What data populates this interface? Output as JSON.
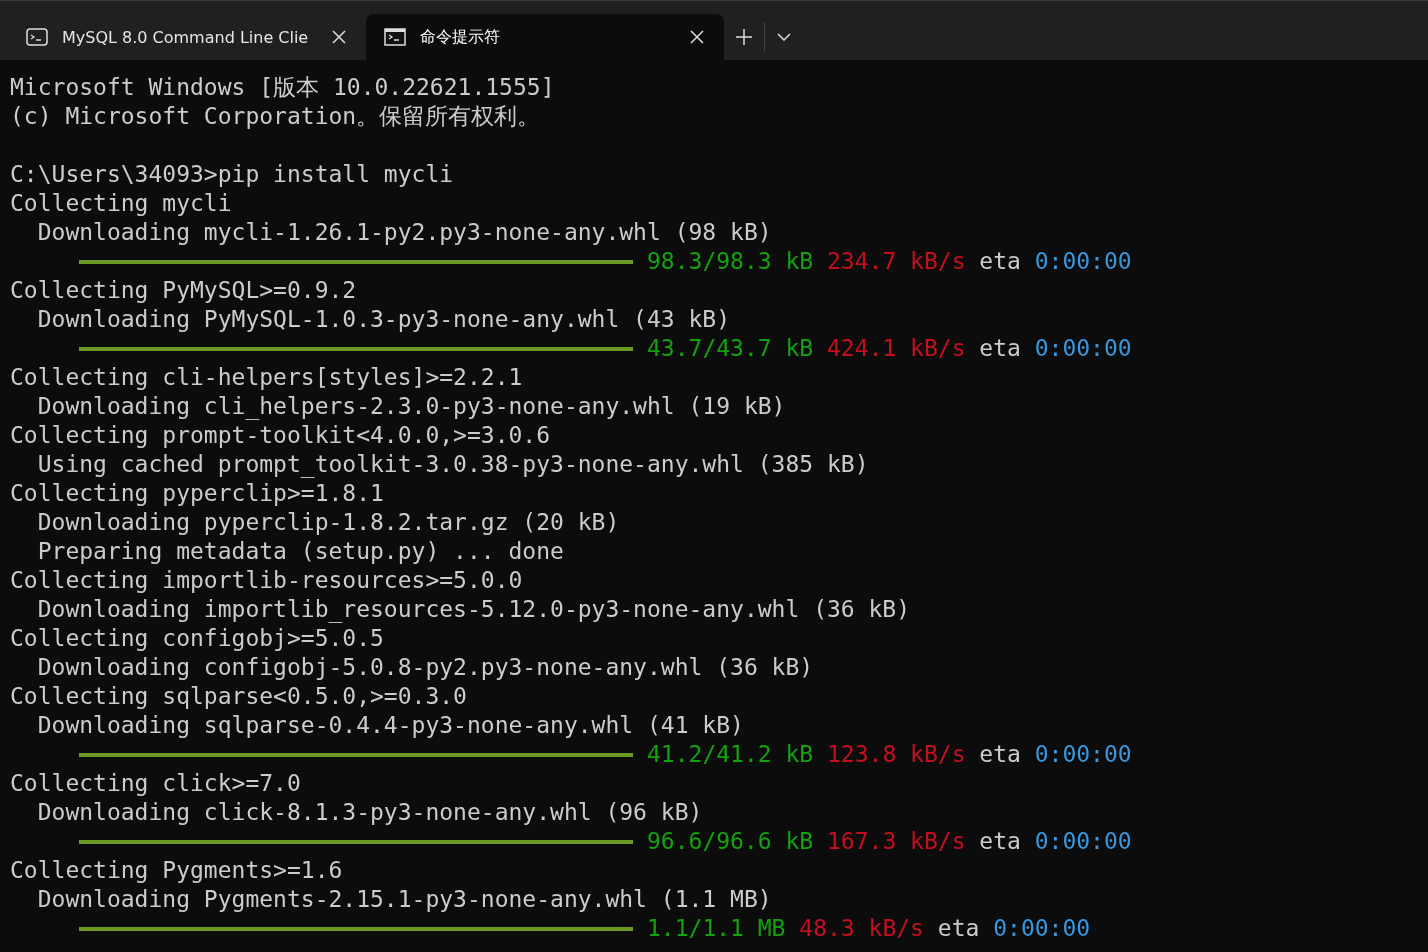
{
  "tabs": [
    {
      "title": "MySQL 8.0 Command Line Clie",
      "selected": false
    },
    {
      "title": "命令提示符",
      "selected": true
    }
  ],
  "terminal": {
    "lines": [
      {
        "kind": "text",
        "text": "Microsoft Windows [版本 10.0.22621.1555]"
      },
      {
        "kind": "text",
        "text": "(c) Microsoft Corporation。保留所有权利。"
      },
      {
        "kind": "blank"
      },
      {
        "kind": "text",
        "text": "C:\\Users\\34093>pip install mycli"
      },
      {
        "kind": "text",
        "text": "Collecting mycli"
      },
      {
        "kind": "text",
        "text": "  Downloading mycli-1.26.1-py2.py3-none-any.whl (98 kB)"
      },
      {
        "kind": "progress",
        "level": 1,
        "amount": "98.3/98.3 kB",
        "speed": "234.7 kB/s",
        "eta_label": "eta",
        "eta": "0:00:00"
      },
      {
        "kind": "text",
        "text": "Collecting PyMySQL>=0.9.2"
      },
      {
        "kind": "text",
        "text": "  Downloading PyMySQL-1.0.3-py3-none-any.whl (43 kB)"
      },
      {
        "kind": "progress",
        "level": 1,
        "amount": "43.7/43.7 kB",
        "speed": "424.1 kB/s",
        "eta_label": "eta",
        "eta": "0:00:00"
      },
      {
        "kind": "text",
        "text": "Collecting cli-helpers[styles]>=2.2.1"
      },
      {
        "kind": "text",
        "text": "  Downloading cli_helpers-2.3.0-py3-none-any.whl (19 kB)"
      },
      {
        "kind": "text",
        "text": "Collecting prompt-toolkit<4.0.0,>=3.0.6"
      },
      {
        "kind": "text",
        "text": "  Using cached prompt_toolkit-3.0.38-py3-none-any.whl (385 kB)"
      },
      {
        "kind": "text",
        "text": "Collecting pyperclip>=1.8.1"
      },
      {
        "kind": "text",
        "text": "  Downloading pyperclip-1.8.2.tar.gz (20 kB)"
      },
      {
        "kind": "text",
        "text": "  Preparing metadata (setup.py) ... done"
      },
      {
        "kind": "text",
        "text": "Collecting importlib-resources>=5.0.0"
      },
      {
        "kind": "text",
        "text": "  Downloading importlib_resources-5.12.0-py3-none-any.whl (36 kB)"
      },
      {
        "kind": "text",
        "text": "Collecting configobj>=5.0.5"
      },
      {
        "kind": "text",
        "text": "  Downloading configobj-5.0.8-py2.py3-none-any.whl (36 kB)"
      },
      {
        "kind": "text",
        "text": "Collecting sqlparse<0.5.0,>=0.3.0"
      },
      {
        "kind": "text",
        "text": "  Downloading sqlparse-0.4.4-py3-none-any.whl (41 kB)"
      },
      {
        "kind": "progress",
        "level": 1,
        "amount": "41.2/41.2 kB",
        "speed": "123.8 kB/s",
        "eta_label": "eta",
        "eta": "0:00:00"
      },
      {
        "kind": "text",
        "text": "Collecting click>=7.0"
      },
      {
        "kind": "text",
        "text": "  Downloading click-8.1.3-py3-none-any.whl (96 kB)"
      },
      {
        "kind": "progress",
        "level": 1,
        "amount": "96.6/96.6 kB",
        "speed": "167.3 kB/s",
        "eta_label": "eta",
        "eta": "0:00:00"
      },
      {
        "kind": "text",
        "text": "Collecting Pygments>=1.6"
      },
      {
        "kind": "text",
        "text": "  Downloading Pygments-2.15.1-py3-none-any.whl (1.1 MB)"
      },
      {
        "kind": "progress",
        "level": 1,
        "amount": "1.1/1.1 MB",
        "speed": "48.3 kB/s",
        "eta_label": "eta",
        "eta": "0:00:00"
      }
    ]
  }
}
